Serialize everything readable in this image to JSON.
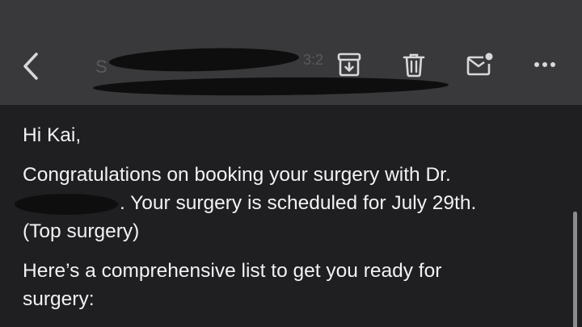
{
  "header": {
    "sender_partial": "S",
    "time_partial": "3:2",
    "icons": {
      "back": "chevron-left-icon",
      "archive": "archive-box-icon",
      "delete": "trash-icon",
      "mark_unread": "mail-unread-icon",
      "more": "more-horizontal-icon"
    },
    "icon_color": "#d8d8da",
    "background_color": "#39393b"
  },
  "email": {
    "greeting": "Hi Kai,",
    "para1_line1": "Congratulations on booking your surgery with Dr.",
    "para1_line2": ". Your surgery is scheduled for July 29th.",
    "para1_line3": "(Top surgery)",
    "para2_line1": "Here’s a comprehensive list to get you ready for",
    "para2_line2": "surgery:"
  },
  "colors": {
    "body_background": "#1f1f21",
    "text": "#f2f2f4",
    "redaction": "#0e0e0f"
  }
}
